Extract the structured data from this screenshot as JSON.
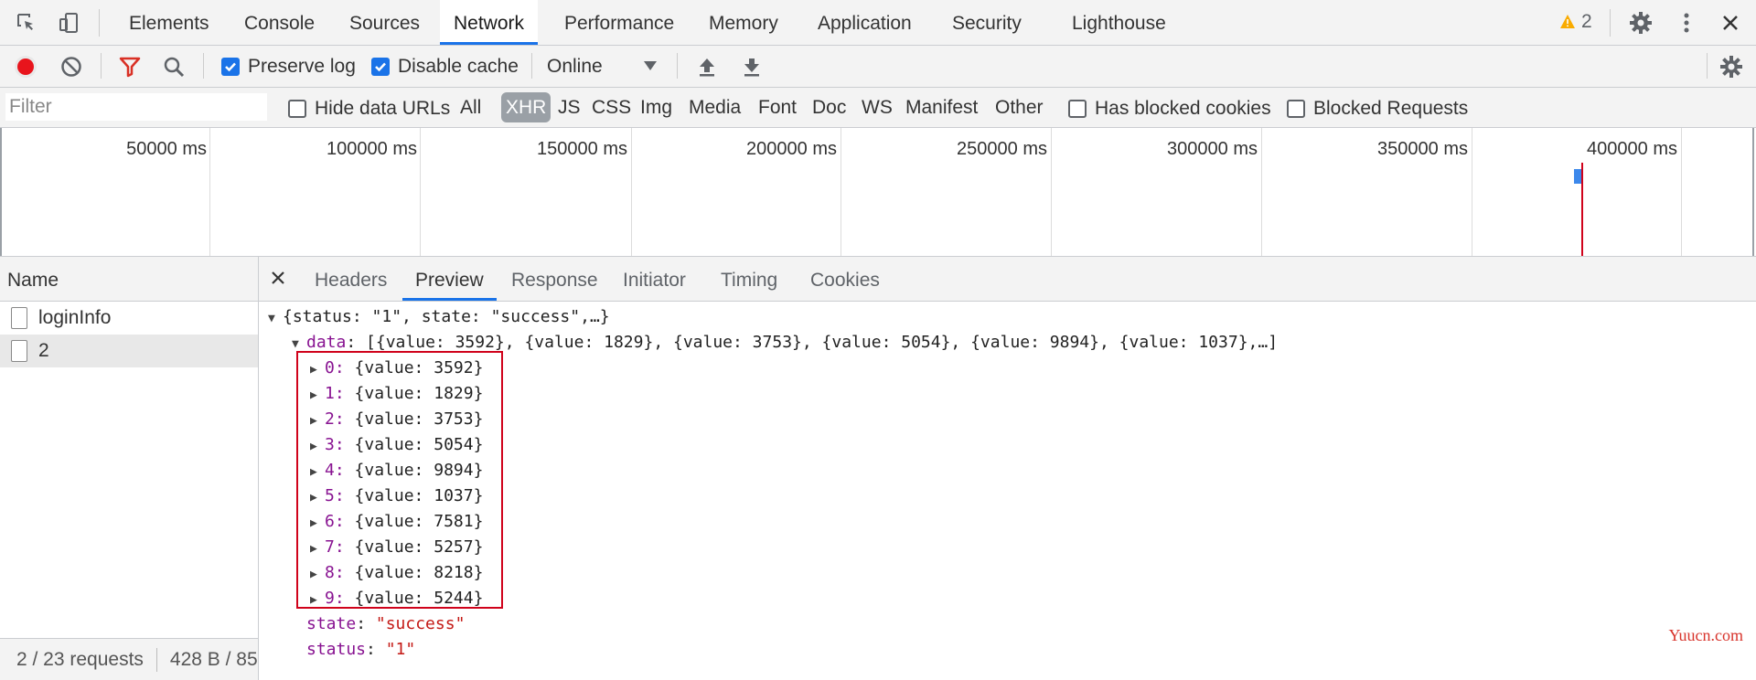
{
  "tabs": {
    "elements": "Elements",
    "console": "Console",
    "sources": "Sources",
    "network": "Network",
    "performance": "Performance",
    "memory": "Memory",
    "application": "Application",
    "security": "Security",
    "lighthouse": "Lighthouse"
  },
  "warnings_count": "2",
  "toolbar": {
    "preserve_log": "Preserve log",
    "disable_cache": "Disable cache",
    "throttle": "Online"
  },
  "filter": {
    "placeholder": "Filter",
    "hide_data_urls": "Hide data URLs",
    "types": [
      "All",
      "XHR",
      "JS",
      "CSS",
      "Img",
      "Media",
      "Font",
      "Doc",
      "WS",
      "Manifest",
      "Other"
    ],
    "selected_type": "XHR",
    "has_blocked_cookies": "Has blocked cookies",
    "blocked_requests": "Blocked Requests"
  },
  "timeline": {
    "ticks": [
      "50000 ms",
      "100000 ms",
      "150000 ms",
      "200000 ms",
      "250000 ms",
      "300000 ms",
      "350000 ms",
      "400000 ms"
    ]
  },
  "requests": {
    "header": "Name",
    "items": [
      "loginInfo",
      "2"
    ],
    "summary": "2 / 23 requests",
    "size": "428 B / 85"
  },
  "detail_tabs": {
    "headers": "Headers",
    "preview": "Preview",
    "response": "Response",
    "initiator": "Initiator",
    "timing": "Timing",
    "cookies": "Cookies"
  },
  "preview": {
    "root_summary": "{status: \"1\", state: \"success\",…}",
    "data_key": "data",
    "data_summary": "[{value: 3592}, {value: 1829}, {value: 3753}, {value: 5054}, {value: 9894}, {value: 1037},…]",
    "items": [
      {
        "index": "0",
        "text": "{value: 3592}"
      },
      {
        "index": "1",
        "text": "{value: 1829}"
      },
      {
        "index": "2",
        "text": "{value: 3753}"
      },
      {
        "index": "3",
        "text": "{value: 5054}"
      },
      {
        "index": "4",
        "text": "{value: 9894}"
      },
      {
        "index": "5",
        "text": "{value: 1037}"
      },
      {
        "index": "6",
        "text": "{value: 7581}"
      },
      {
        "index": "7",
        "text": "{value: 5257}"
      },
      {
        "index": "8",
        "text": "{value: 8218}"
      },
      {
        "index": "9",
        "text": "{value: 5244}"
      }
    ],
    "state_key": "state",
    "state_value": "\"success\"",
    "status_key": "status",
    "status_value": "\"1\""
  },
  "watermark": "Yuucn.com",
  "colors": {
    "accent": "#1a73e8",
    "record": "#e8141c",
    "highlight_box": "#d0021b",
    "json_key": "#881391",
    "json_string": "#c41a16"
  }
}
